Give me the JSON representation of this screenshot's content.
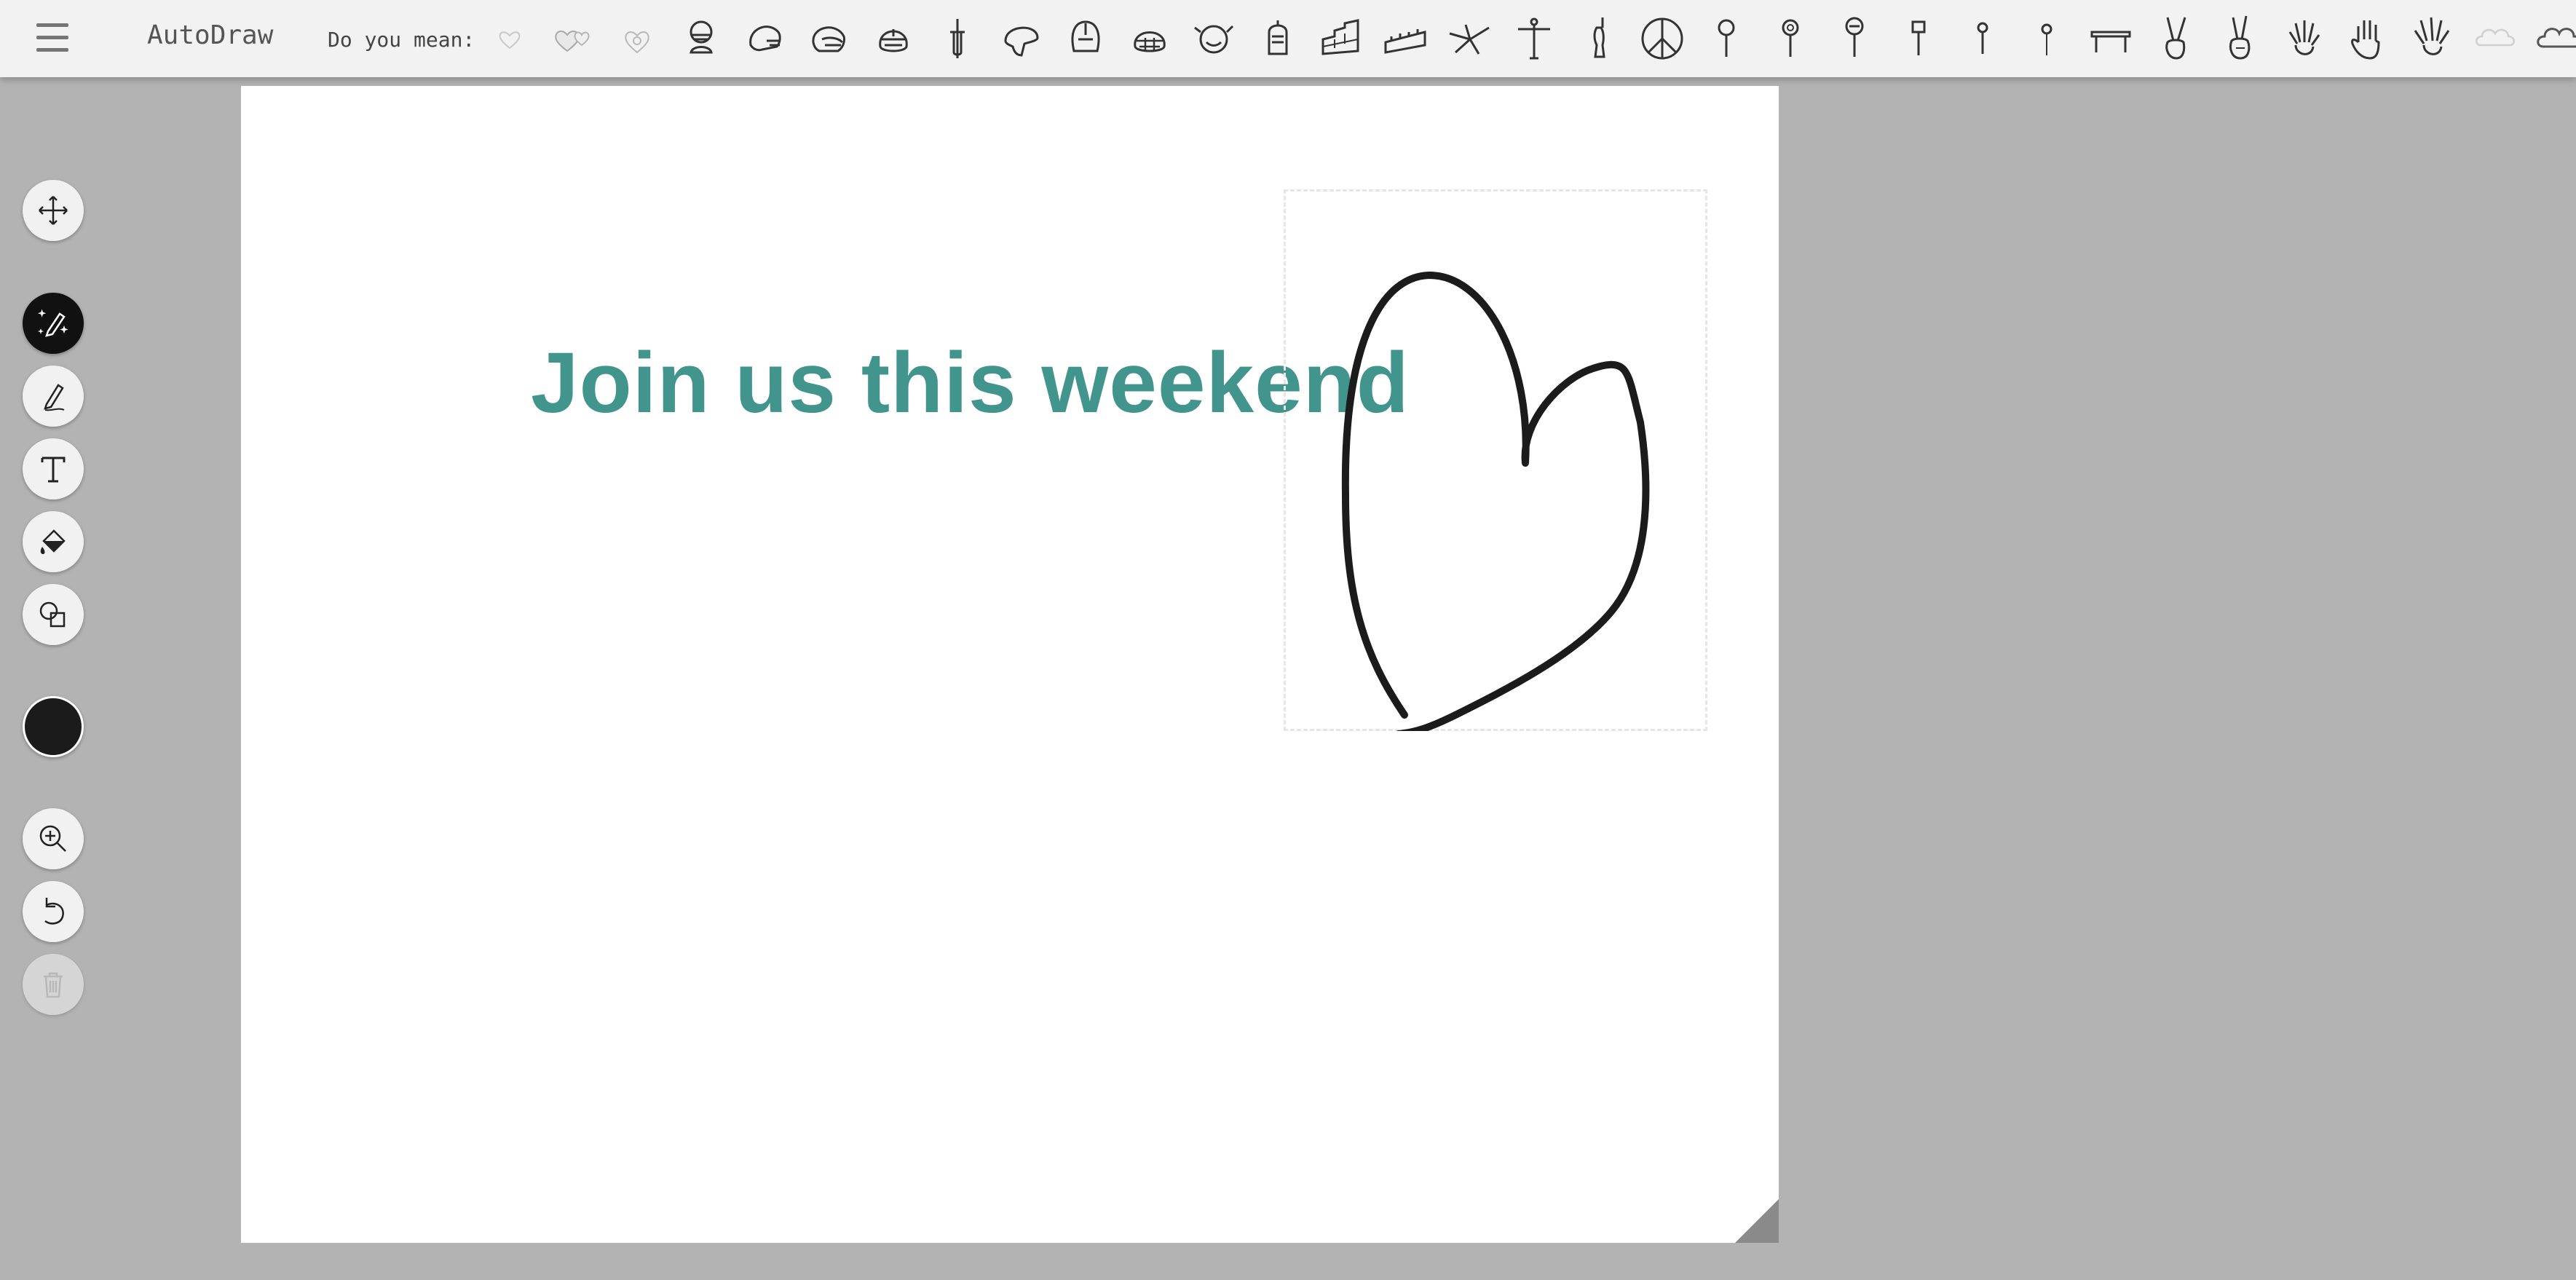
{
  "app": {
    "title": "AutoDraw"
  },
  "toolbar_top": {
    "suggest_label": "Do you mean:",
    "suggestions": [
      "heart-icon",
      "hearts-icon",
      "heart-pendant-icon",
      "football-player-icon",
      "football-helmet-icon",
      "football-helmet-side-icon",
      "football-helmet-front-icon",
      "dagger-icon",
      "helmet-icon",
      "helmet-visor-icon",
      "football-helmet-grill-icon",
      "dragon-helmet-icon",
      "knight-helmet-icon",
      "great-wall-icon",
      "great-wall-alt-icon",
      "leaning-structure-icon",
      "christ-redeemer-icon",
      "statue-of-liberty-icon",
      "peace-sign-icon",
      "pin-icon",
      "pin-target-icon",
      "stop-sign-icon",
      "sign-post-icon",
      "pin-small-icon",
      "pin-thin-icon",
      "table-icon",
      "peace-hand-icon",
      "peace-hand-alt-icon",
      "hand-icon",
      "hand-open-icon",
      "hand-spread-icon",
      "cloud-light-icon",
      "cloud-icon"
    ]
  },
  "canvas": {
    "headline": "Join us this weekend",
    "headline_color": "#42958c"
  },
  "tools": [
    {
      "name": "select-tool",
      "icon": "move-icon"
    },
    {
      "name": "autodraw-tool",
      "icon": "autodraw-pencil-icon",
      "active": true
    },
    {
      "name": "draw-tool",
      "icon": "pencil-icon"
    },
    {
      "name": "type-tool",
      "icon": "text-icon"
    },
    {
      "name": "fill-tool",
      "icon": "paint-bucket-icon"
    },
    {
      "name": "shape-tool",
      "icon": "shapes-icon"
    },
    {
      "name": "color-tool",
      "icon": "color-swatch",
      "color": "#1b1b1b"
    },
    {
      "name": "zoom-tool",
      "icon": "zoom-in-icon"
    },
    {
      "name": "undo-tool",
      "icon": "undo-icon"
    },
    {
      "name": "delete-tool",
      "icon": "trash-icon",
      "disabled": true
    }
  ]
}
